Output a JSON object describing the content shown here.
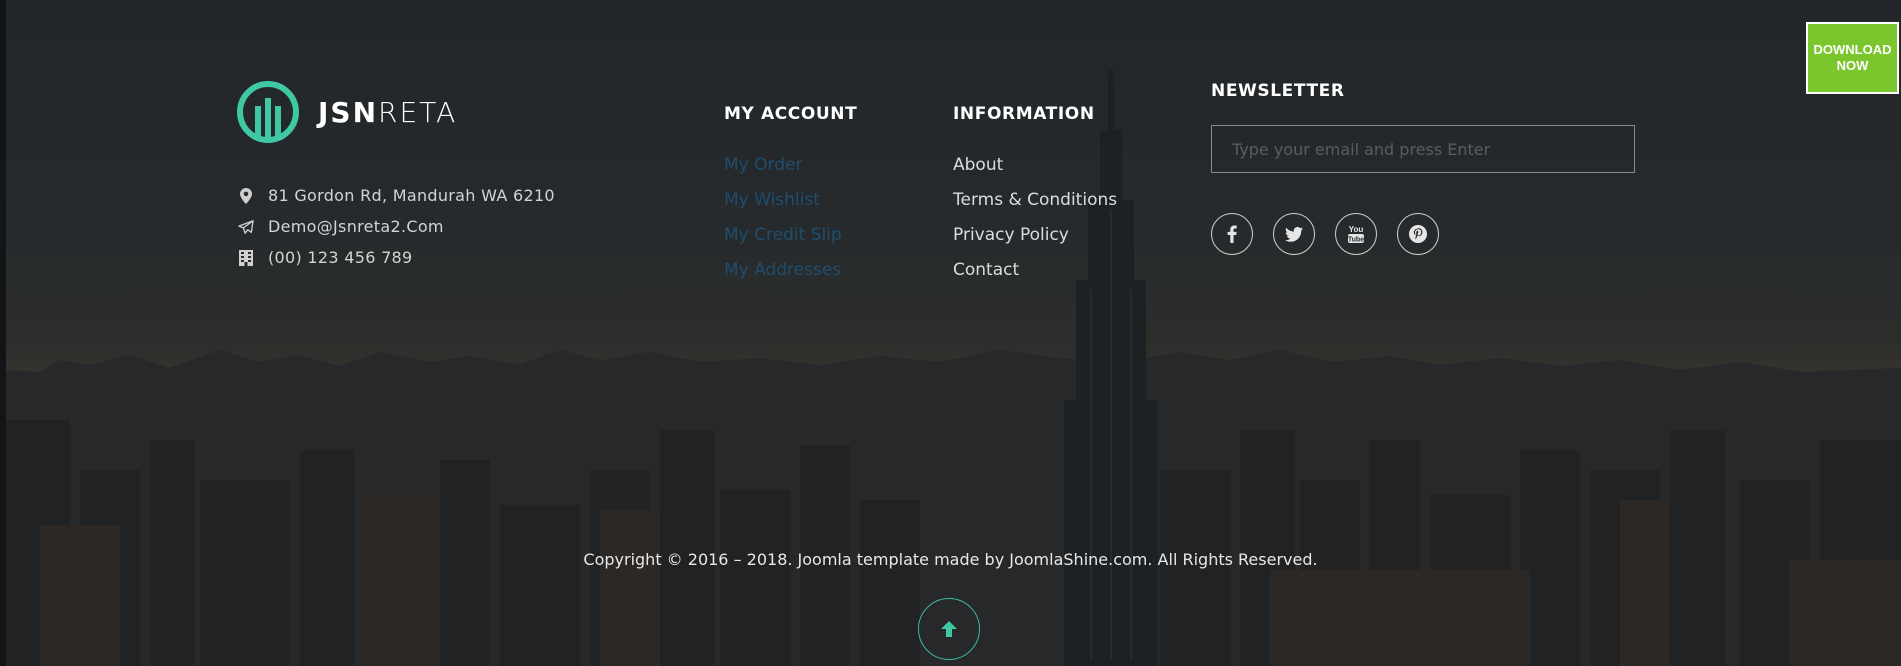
{
  "brand": {
    "name_bold": "JSN",
    "name_light": "RETA",
    "logo_icon": "jsnreta-logo-icon",
    "accent": "#3fc8a3"
  },
  "contact": [
    {
      "icon": "location-pin-icon",
      "text": "81 Gordon Rd, Mandurah WA 6210"
    },
    {
      "icon": "paper-plane-icon",
      "text": "Demo@Jsnreta2.Com"
    },
    {
      "icon": "building-icon",
      "text": "(00) 123 456 789"
    }
  ],
  "account": {
    "title": "MY ACCOUNT",
    "links": [
      "My Order",
      "My Wishlist",
      "My Credit Slip",
      "My Addresses"
    ],
    "link_color": "#1f4d6f"
  },
  "information": {
    "title": "INFORMATION",
    "links": [
      "About",
      "Terms & Conditions",
      "Privacy Policy",
      "Contact"
    ]
  },
  "newsletter": {
    "title": "NEWSLETTER",
    "placeholder": "Type your email and press Enter",
    "social": [
      "facebook-icon",
      "twitter-icon",
      "youtube-icon",
      "pinterest-icon"
    ]
  },
  "download": {
    "line1": "DOWNLOAD",
    "line2": "NOW",
    "color": "#7bc62d"
  },
  "copyright": "Copyright © 2016 – 2018. Joomla template made by JoomlaShine.com. All Rights Reserved.",
  "back_to_top": {
    "icon": "arrow-up-icon"
  }
}
